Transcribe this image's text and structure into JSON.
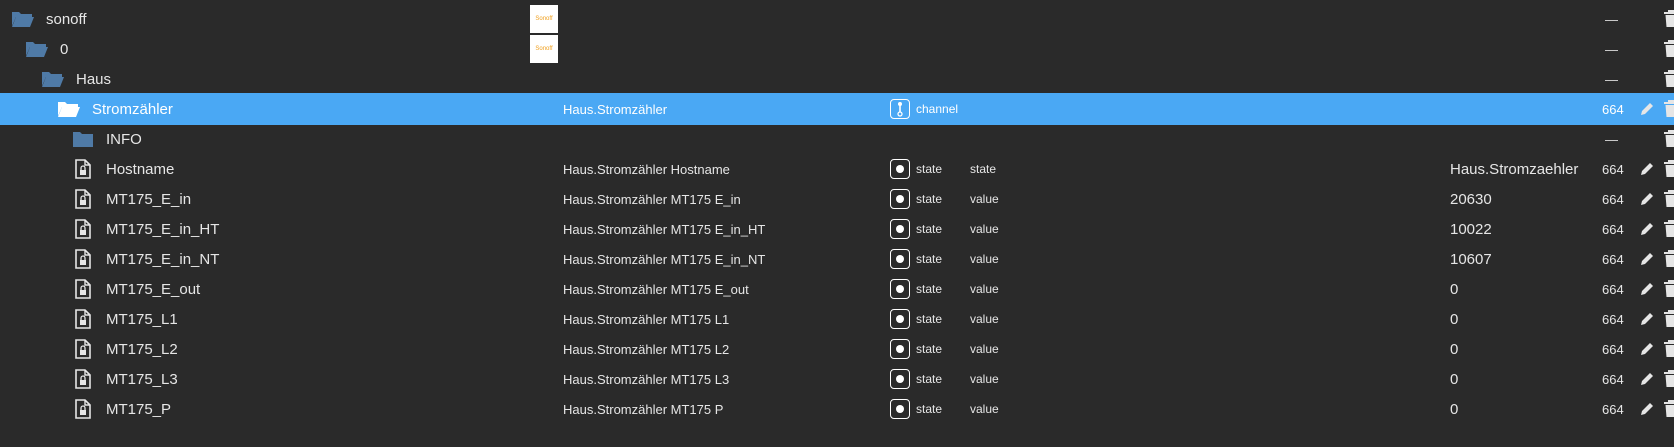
{
  "rows": [
    {
      "type": "folder-open",
      "name": "sonoff",
      "logo": "Sonoff"
    },
    {
      "type": "folder-open",
      "name": "0",
      "logo": "Sonoff"
    },
    {
      "type": "folder-open",
      "name": "Haus"
    },
    {
      "type": "folder-open",
      "name": "Stromzähler",
      "objname": "Haus.Stromzähler",
      "role_type": "channel",
      "acl": "664",
      "selected": true
    },
    {
      "type": "folder",
      "name": "INFO"
    },
    {
      "type": "file",
      "name": "Hostname",
      "objname": "Haus.Stromzähler Hostname",
      "role_type": "state",
      "role": "state",
      "value": "Haus.Stromzaehler",
      "acl": "664"
    },
    {
      "type": "file",
      "name": "MT175_E_in",
      "objname": "Haus.Stromzähler MT175 E_in",
      "role_type": "state",
      "role": "value",
      "value": "20630",
      "acl": "664"
    },
    {
      "type": "file",
      "name": "MT175_E_in_HT",
      "objname": "Haus.Stromzähler MT175 E_in_HT",
      "role_type": "state",
      "role": "value",
      "value": "10022",
      "acl": "664"
    },
    {
      "type": "file",
      "name": "MT175_E_in_NT",
      "objname": "Haus.Stromzähler MT175 E_in_NT",
      "role_type": "state",
      "role": "value",
      "value": "10607",
      "acl": "664"
    },
    {
      "type": "file",
      "name": "MT175_E_out",
      "objname": "Haus.Stromzähler MT175 E_out",
      "role_type": "state",
      "role": "value",
      "value": "0",
      "acl": "664"
    },
    {
      "type": "file",
      "name": "MT175_L1",
      "objname": "Haus.Stromzähler MT175 L1",
      "role_type": "state",
      "role": "value",
      "value": "0",
      "acl": "664"
    },
    {
      "type": "file",
      "name": "MT175_L2",
      "objname": "Haus.Stromzähler MT175 L2",
      "role_type": "state",
      "role": "value",
      "value": "0",
      "acl": "664"
    },
    {
      "type": "file",
      "name": "MT175_L3",
      "objname": "Haus.Stromzähler MT175 L3",
      "role_type": "state",
      "role": "value",
      "value": "0",
      "acl": "664"
    },
    {
      "type": "file",
      "name": "MT175_P",
      "objname": "Haus.Stromzähler MT175 P",
      "role_type": "state",
      "role": "value",
      "value": "0",
      "acl": "664"
    }
  ],
  "dash_label": "—",
  "colors": {
    "background": "#2a2a2a",
    "selected": "#4aa8f4",
    "folder": "#4f7aa6"
  },
  "icons": {
    "folder_open": "folder-open-icon",
    "folder": "folder-icon",
    "file": "file-lock-icon",
    "edit": "pencil-icon",
    "delete": "trash-icon",
    "state": "state-role-icon",
    "channel": "channel-role-icon"
  }
}
